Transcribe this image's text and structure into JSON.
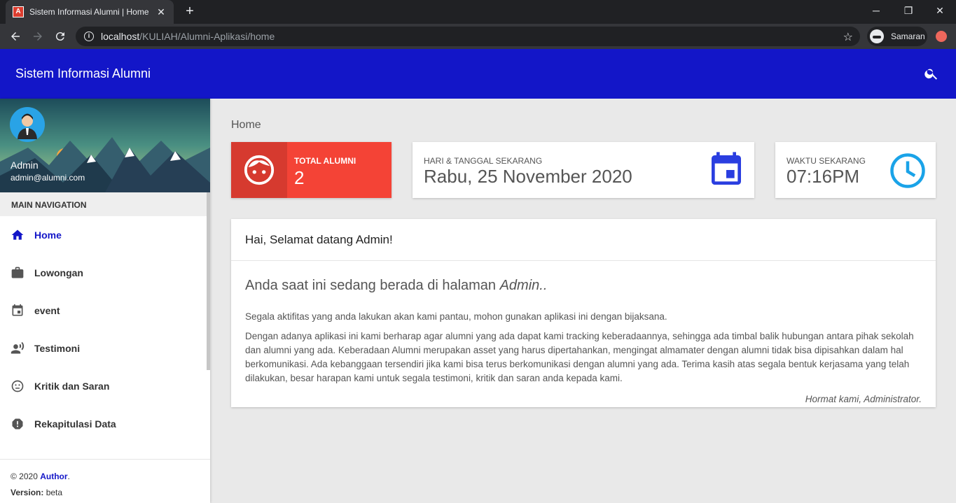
{
  "browser": {
    "tab_title": "Sistem Informasi Alumni | Home",
    "tab_close": "✕",
    "new_tab": "+",
    "url_host": "localhost",
    "url_path": "/KULIAH/Alumni-Aplikasi/home",
    "profile_name": "Samaran",
    "window_minimize": "─",
    "window_restore": "❐",
    "window_close": "✕"
  },
  "header": {
    "brand": "Sistem Informasi Alumni",
    "color": "#1316c8"
  },
  "sidebar": {
    "user_name": "Admin",
    "user_email": "admin@alumni.com",
    "nav_heading": "MAIN NAVIGATION",
    "items": [
      {
        "label": "Home",
        "icon": "home-icon",
        "active": true
      },
      {
        "label": "Lowongan",
        "icon": "briefcase-icon"
      },
      {
        "label": "event",
        "icon": "event-icon"
      },
      {
        "label": "Testimoni",
        "icon": "record-voice-icon"
      },
      {
        "label": "Kritik dan Saran",
        "icon": "face-icon"
      },
      {
        "label": "Rekapitulasi Data",
        "icon": "report-icon"
      }
    ],
    "footer": {
      "copyright": "© 2020 ",
      "author_link": "Author",
      "period": ".",
      "version_label": "Version:",
      "version_value": " beta"
    }
  },
  "main": {
    "breadcrumb": "Home",
    "info_boxes": [
      {
        "label": "TOTAL ALUMNI",
        "value": "2",
        "color": "#f44336",
        "icon": "face-icon"
      },
      {
        "label": "HARI & TANGGAL SEKARANG",
        "value": "Rabu, 25 November 2020",
        "color": "#2a3ee0",
        "icon": "calendar-icon"
      },
      {
        "label": "WAKTU SEKARANG",
        "value": "07:16PM",
        "color": "#1aa3e8",
        "icon": "clock-icon"
      }
    ],
    "panel": {
      "greeting": "Hai, Selamat datang Admin!",
      "heading_prefix": "Anda saat ini sedang berada di halaman ",
      "heading_role": "Admin..",
      "paragraph1": "Segala aktifitas yang anda lakukan akan kami pantau, mohon gunakan aplikasi ini dengan bijaksana.",
      "paragraph2": "Dengan adanya aplikasi ini kami berharap agar alumni yang ada dapat kami tracking keberadaannya, sehingga ada timbal balik hubungan antara pihak sekolah dan alumni yang ada. Keberadaan Alumni merupakan asset yang harus dipertahankan, mengingat almamater dengan alumni tidak bisa dipisahkan dalam hal berkomunikasi. Ada kebanggaan tersendiri jika kami bisa terus berkomunikasi dengan alumni yang ada. Terima kasih atas segala bentuk kerjasama yang telah dilakukan, besar harapan kami untuk segala testimoni, kritik dan saran anda kepada kami.",
      "signature": "Hormat kami, Administrator."
    }
  }
}
